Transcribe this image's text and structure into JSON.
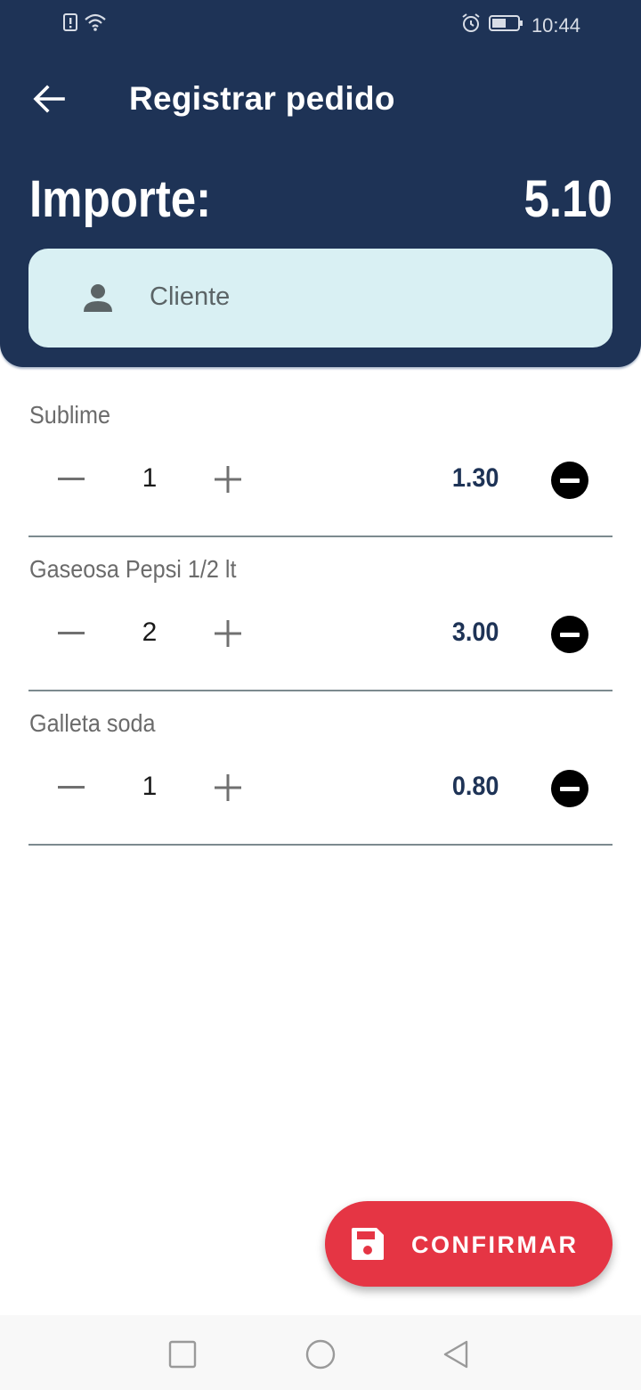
{
  "status_bar": {
    "time": "10:44",
    "icons": [
      "alert-icon",
      "wifi-icon",
      "alarm-icon",
      "battery-icon"
    ]
  },
  "header": {
    "title": "Registrar pedido",
    "back_icon": "arrow-back-icon"
  },
  "summary": {
    "amount_label": "Importe:",
    "amount_value": "5.10"
  },
  "client": {
    "placeholder": "Cliente",
    "icon": "person-icon"
  },
  "items": [
    {
      "name": "Sublime",
      "quantity": "1",
      "price": "1.30"
    },
    {
      "name": "Gaseosa Pepsi 1/2 lt",
      "quantity": "2",
      "price": "3.00"
    },
    {
      "name": "Galleta soda",
      "quantity": "1",
      "price": "0.80"
    }
  ],
  "fab": {
    "label": "CONFIRMAR",
    "icon": "save-icon"
  },
  "nav": {
    "icons": [
      "recents-square-icon",
      "home-circle-icon",
      "back-triangle-icon"
    ]
  },
  "colors": {
    "header_bg": "#1e3356",
    "client_field_bg": "#d9f0f3",
    "accent_red": "#e53544",
    "price_text": "#1e3356"
  }
}
